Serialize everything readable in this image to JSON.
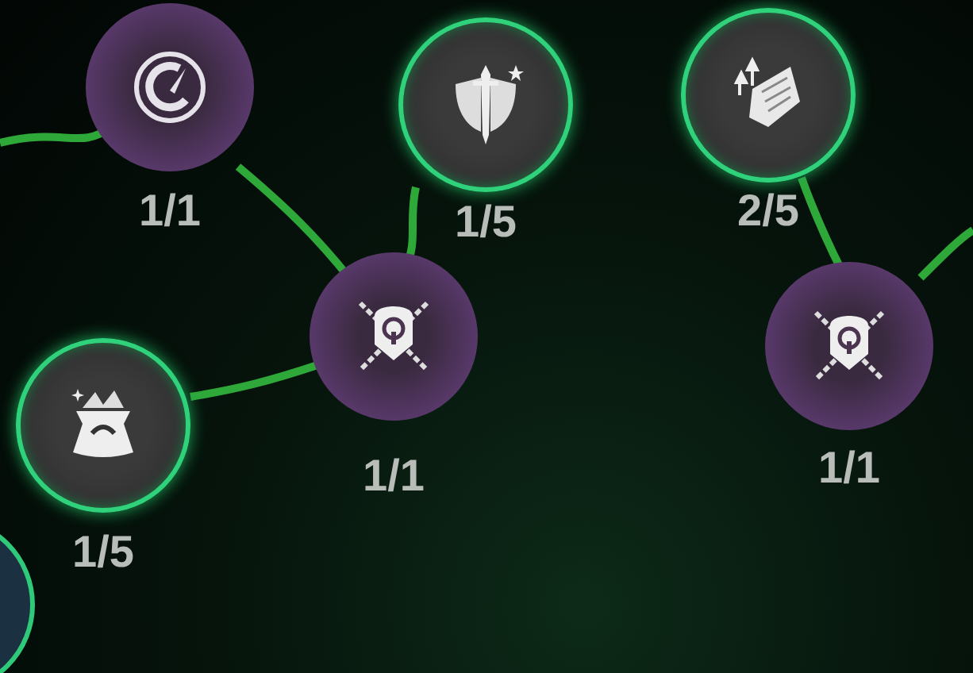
{
  "skill_nodes": [
    {
      "kind": "keystone",
      "rank": "1/1"
    },
    {
      "kind": "upgrade",
      "rank": "1/5"
    },
    {
      "kind": "upgrade",
      "rank": "2/5"
    },
    {
      "kind": "keystone",
      "rank": "1/1"
    },
    {
      "kind": "keystone",
      "rank": "1/1"
    },
    {
      "kind": "upgrade",
      "rank": "1/5"
    }
  ]
}
